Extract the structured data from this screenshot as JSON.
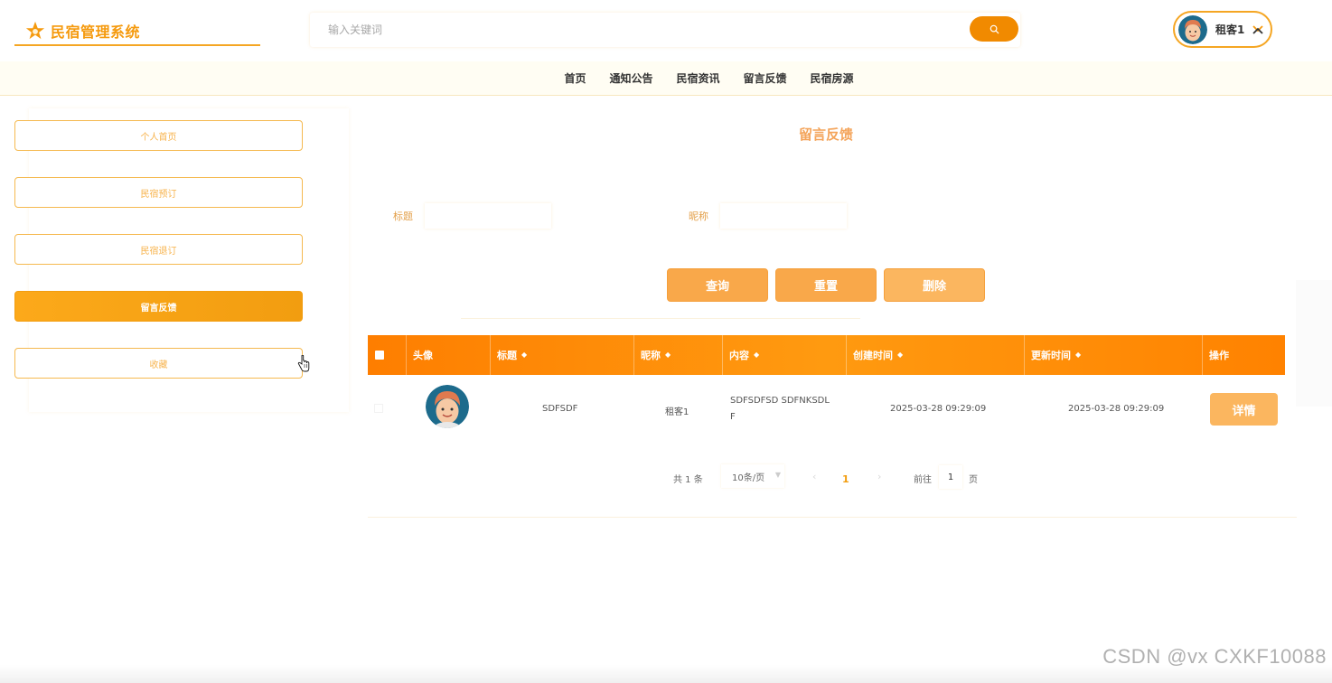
{
  "app": {
    "title": "民宿管理系统",
    "accent": "#f59a0e",
    "brand_orange": "#f18a00"
  },
  "header": {
    "search_placeholder": "输入关键词",
    "search_icon": "search-icon",
    "user_name": "租客1",
    "user_menu_icon": "chevron-down-icon"
  },
  "nav": {
    "items": [
      {
        "label": "首页"
      },
      {
        "label": "通知公告"
      },
      {
        "label": "民宿资讯"
      },
      {
        "label": "留言反馈"
      },
      {
        "label": "民宿房源"
      }
    ]
  },
  "sidebar": {
    "items": [
      {
        "label": "个人首页",
        "active": false
      },
      {
        "label": "民宿预订",
        "active": false
      },
      {
        "label": "民宿退订",
        "active": false
      },
      {
        "label": "留言反馈",
        "active": true
      },
      {
        "label": "收藏",
        "active": false
      }
    ]
  },
  "main": {
    "title": "留言反馈",
    "filters": [
      {
        "label": "标题",
        "value": ""
      },
      {
        "label": "昵称",
        "value": ""
      }
    ],
    "buttons": {
      "query": "查询",
      "reset": "重置",
      "delete": "删除"
    },
    "table": {
      "columns": [
        {
          "label": "头像",
          "sortable": false
        },
        {
          "label": "标题",
          "sortable": true
        },
        {
          "label": "昵称",
          "sortable": true
        },
        {
          "label": "内容",
          "sortable": true
        },
        {
          "label": "创建时间",
          "sortable": true
        },
        {
          "label": "更新时间",
          "sortable": true
        },
        {
          "label": "操作",
          "sortable": false
        }
      ],
      "sort_glyph": "◆",
      "rows": [
        {
          "title": "SDFSDF",
          "nickname": "租客1",
          "content_line1": "SDFSDFSD SDFNKSDL",
          "content_line2": "F",
          "created": "2025-03-28 09:29:09",
          "updated": "2025-03-28 09:29:09",
          "action": "详情"
        }
      ]
    },
    "pagination": {
      "total_text": "共 1 条",
      "page_size": "10条/页",
      "prev": "‹",
      "current": "1",
      "next": "›",
      "goto_label": "前往",
      "goto_value": "1",
      "page_suffix": "页"
    }
  },
  "watermark": "CSDN @vx  CXKF10088"
}
